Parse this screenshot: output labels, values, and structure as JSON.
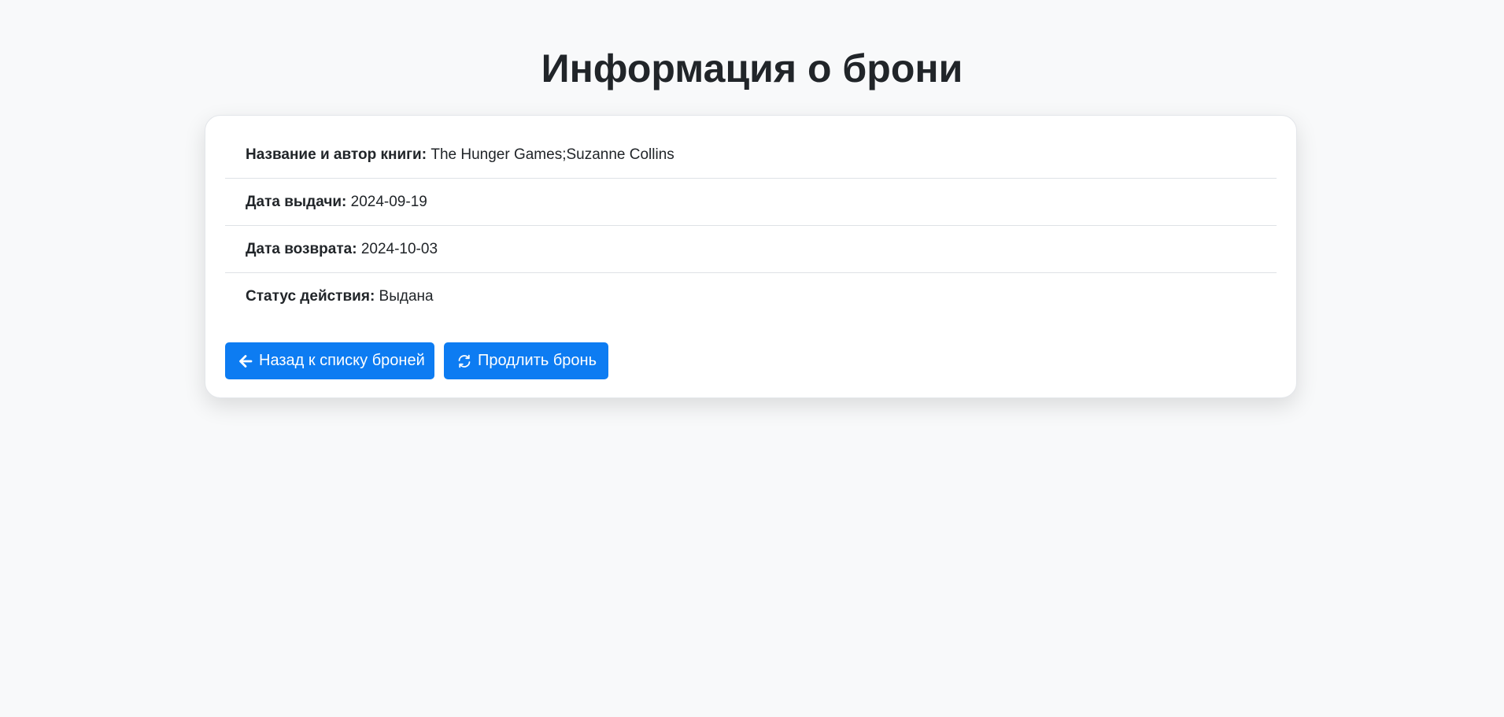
{
  "page": {
    "title": "Информация о брони"
  },
  "details": [
    {
      "label": "Название и автор книги:",
      "value": "The Hunger Games;Suzanne Collins"
    },
    {
      "label": "Дата выдачи:",
      "value": "2024-09-19"
    },
    {
      "label": "Дата возврата:",
      "value": "2024-10-03"
    },
    {
      "label": "Статус действия:",
      "value": "Выдана"
    }
  ],
  "actions": {
    "back_label": "Назад к списку броней",
    "back_icon": "arrow-left-icon",
    "extend_label": "Продлить бронь",
    "extend_icon": "refresh-icon"
  },
  "colors": {
    "primary": "#0d7cf2",
    "background": "#f8f9fa",
    "card": "#ffffff",
    "text": "#212529"
  }
}
